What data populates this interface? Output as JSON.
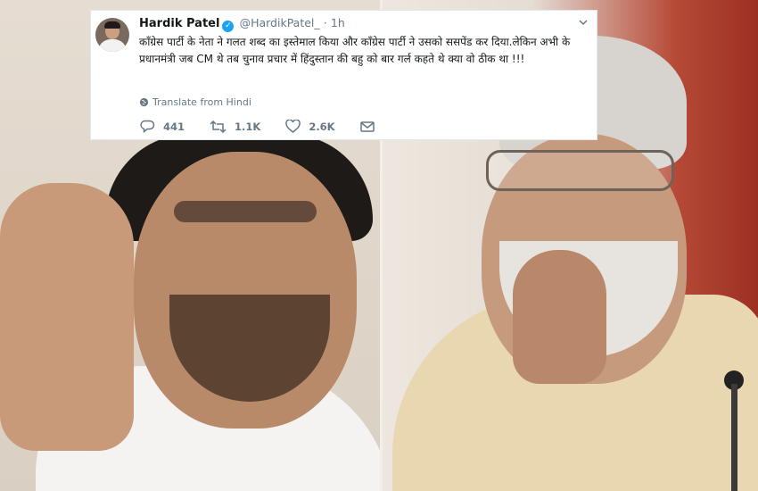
{
  "tweet": {
    "name": "Hardik Patel",
    "handle": "@HardikPatel_",
    "separator": "·",
    "time": "1h",
    "text": "कॉंग्रेस पार्टी के नेता ने गलत शब्द का इस्तेमाल किया और कॉंग्रेस पार्टी ने उसको ससपेंड कर दिया.लेकिन अभी के प्रधानमंत्री जब CM थे तब चुनाव प्रचार में हिंदुस्तान की बहु को बार गर्ल कहते थे क्या वो ठीक था !!!",
    "translate_label": "Translate from Hindi",
    "reply_count": "441",
    "retweet_count": "1.1K",
    "like_count": "2.6K"
  },
  "icons": {
    "verified": "verified-badge-icon",
    "more": "chevron-down-icon",
    "translate": "globe-icon",
    "reply": "reply-icon",
    "retweet": "retweet-icon",
    "like": "heart-icon",
    "message": "envelope-icon"
  },
  "colors": {
    "verified_blue": "#1da1f2",
    "text": "#14171a",
    "muted": "#657786"
  }
}
